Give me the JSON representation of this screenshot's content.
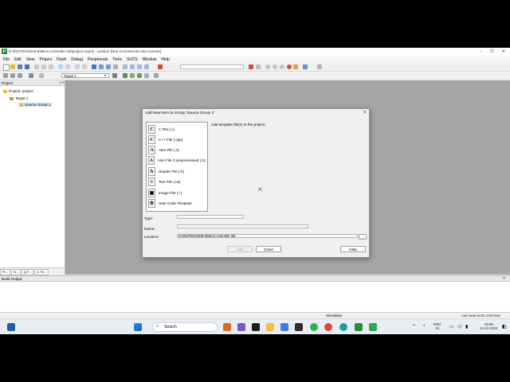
{
  "window": {
    "title": "D:\\INOTES\\SEM-5\\Micro controller lab\\project.uvproj - µVision  [Non-Commercial Use License]",
    "controls": [
      "–",
      "❐",
      "✕"
    ]
  },
  "menu": [
    "File",
    "Edit",
    "View",
    "Project",
    "Flash",
    "Debug",
    "Peripherals",
    "Tools",
    "SVCS",
    "Window",
    "Help"
  ],
  "toolbar": {
    "target": "Target 1"
  },
  "project_panel": {
    "title": "Project",
    "tree": [
      "Project: project",
      "Target 1",
      "Source Group 1"
    ],
    "tabs": [
      "Pr...",
      "B...",
      "{} F...",
      "0. Te..."
    ]
  },
  "dialog": {
    "title": "Add New Item to Group 'Source Group 1'",
    "close": "×",
    "description": "Add template file(s) to the project.",
    "file_types": [
      {
        "icon": "C",
        "label": "C File (.c)"
      },
      {
        "icon": "C",
        "label": "C++ File (.cpp)"
      },
      {
        "icon": "A",
        "label": "Asm File (.s)"
      },
      {
        "icon": "A",
        "label": "Asm File C-preprocessed (.S)"
      },
      {
        "icon": "h",
        "label": "Header File (.h)"
      },
      {
        "icon": "≡",
        "label": "Text File (.txt)"
      },
      {
        "icon": "▣",
        "label": "Image File (.*)"
      },
      {
        "icon": "⚙",
        "label": "User Code Template"
      }
    ],
    "type_label": "Type:",
    "name_label": "Name:",
    "location_label": "Location:",
    "location_value": "D:\\INOTES\\SEM-5\\Micro controller lab",
    "browse": "...",
    "add_button": "Add",
    "close_button": "Close",
    "help_button": "Help"
  },
  "build_output": {
    "title": "Build Output"
  },
  "status": {
    "mode": "Simulation",
    "indicators": "CAP  NUM  SCRL  OVR  R/W"
  },
  "taskbar": {
    "search": "Search",
    "lang_top": "ENG",
    "lang_bottom": "IN",
    "time": "19:59",
    "date": "14-12-2024"
  },
  "colors": {
    "editor_bg": "#a5a5a5",
    "selection": "#cfe3ff",
    "taskbar": "#e9eef5"
  }
}
